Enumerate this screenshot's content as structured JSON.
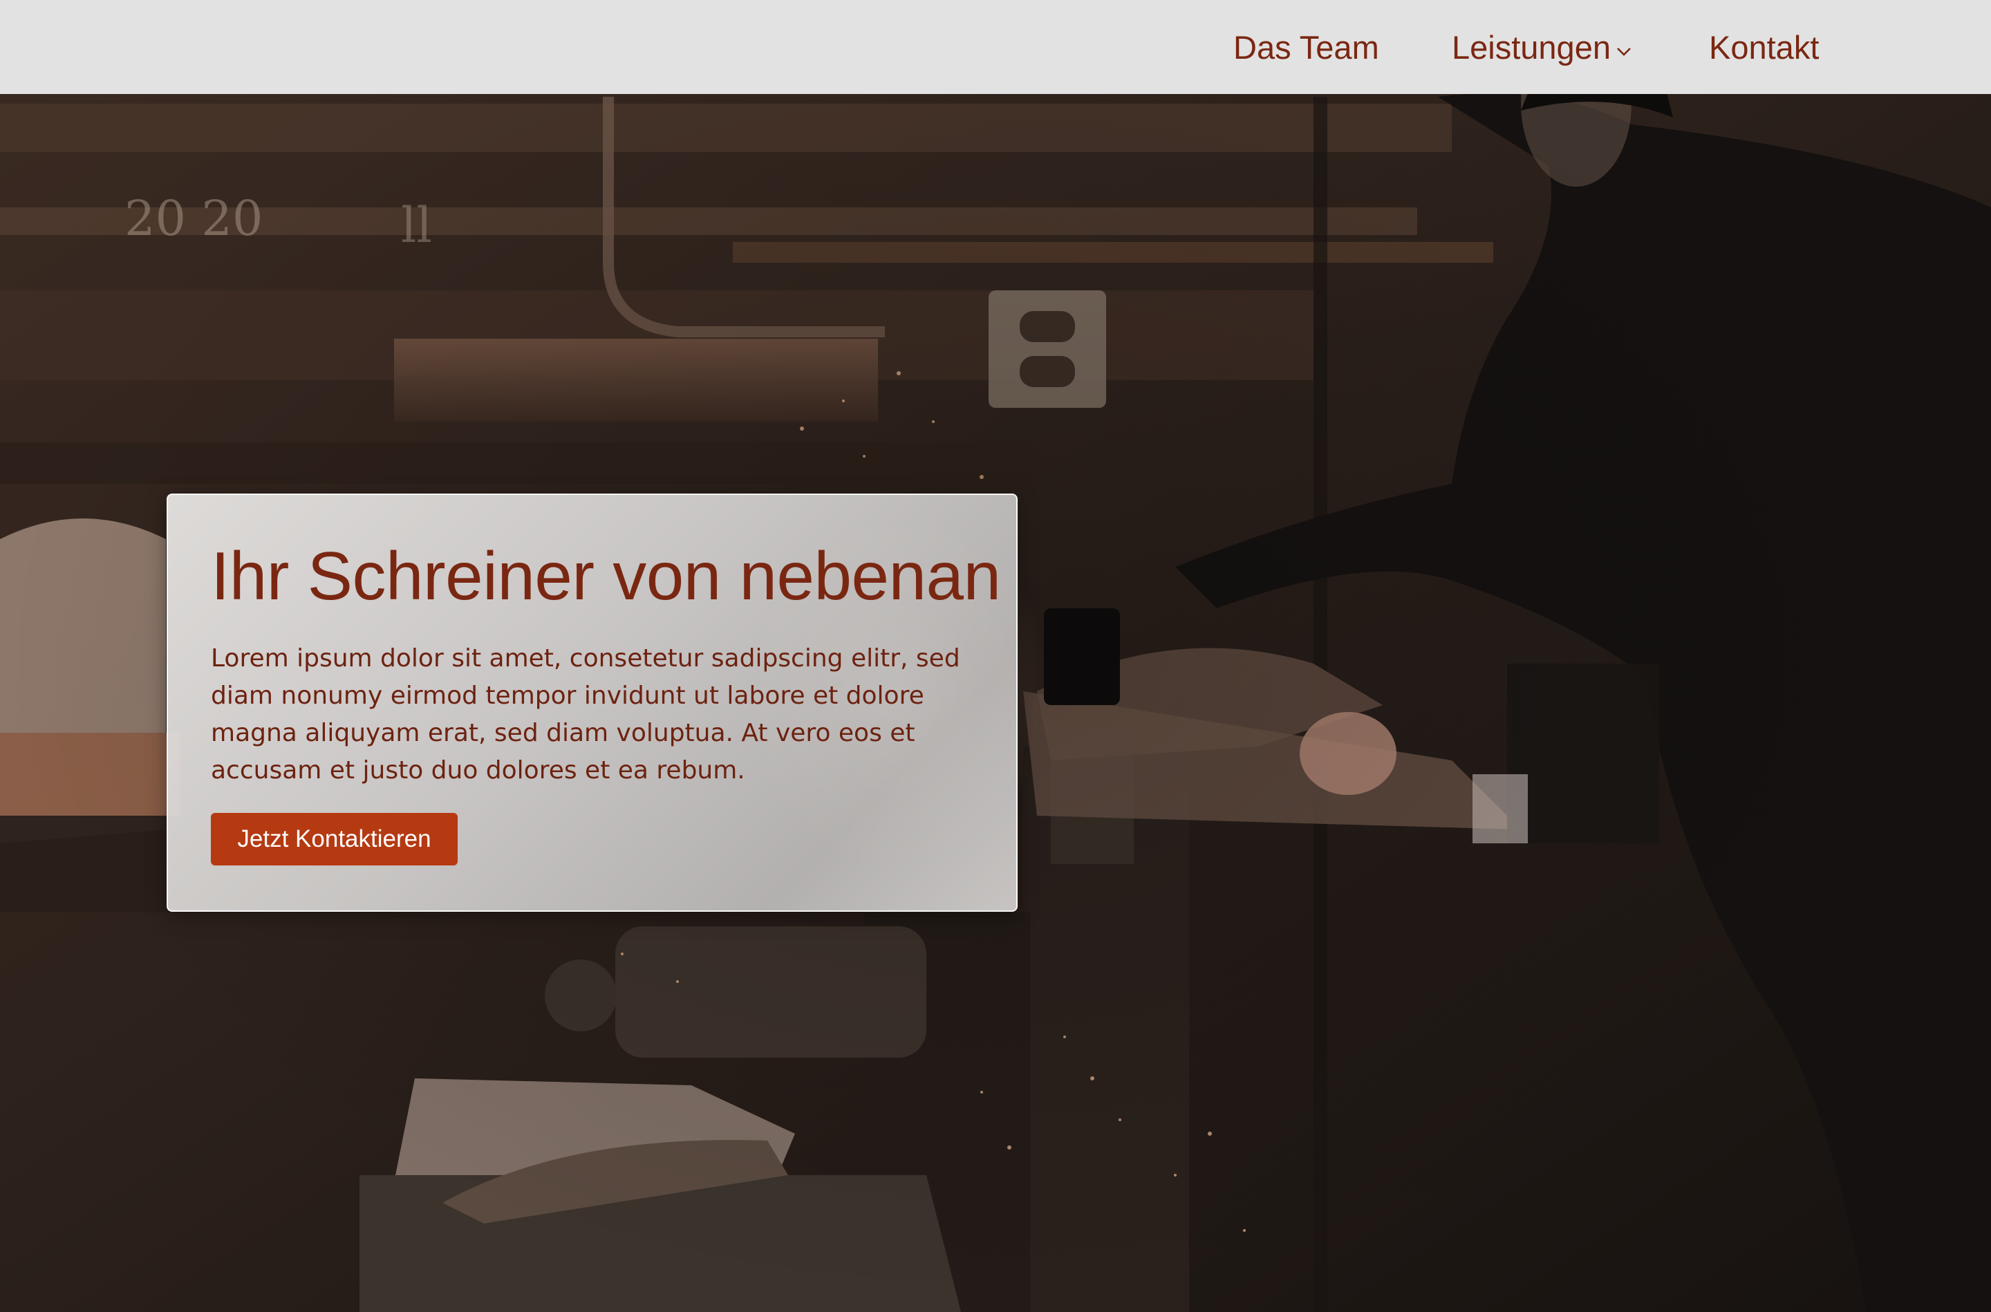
{
  "nav": {
    "items": [
      {
        "label": "Das Team"
      },
      {
        "label": "Leistungen",
        "has_dropdown": true,
        "icon": "chevron-down-icon"
      },
      {
        "label": "Kontakt"
      }
    ]
  },
  "hero": {
    "title": "Ihr Schreiner von nebenan",
    "text": "Lorem ipsum dolor sit amet, consetetur sadipscing elitr, sed diam nonumy eirmod tempor invidunt ut labore et dolore magna aliquyam erat, sed diam voluptua. At vero eos et accusam et justo duo dolores et ea rebum.",
    "cta_label": "Jetzt Kontaktieren"
  },
  "colors": {
    "navbar_background": "#e2e2e2",
    "brand_text": "#7a2712",
    "cta_background": "#b53a12",
    "cta_text": "#ffffff"
  }
}
